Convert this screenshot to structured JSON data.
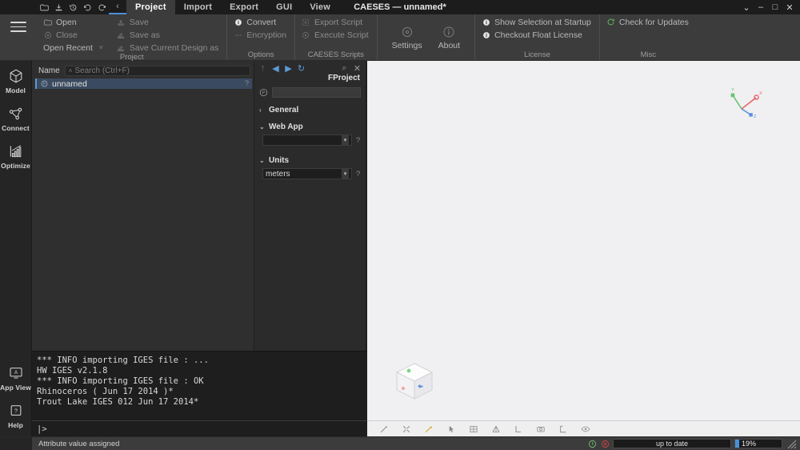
{
  "window": {
    "title": "CAESES — unnamed*",
    "controls": [
      {
        "name": "chevron-down-icon",
        "glyph": "⌄"
      },
      {
        "name": "minimize-button",
        "glyph": "–"
      },
      {
        "name": "maximize-button",
        "glyph": "□"
      },
      {
        "name": "close-button",
        "glyph": "✕"
      }
    ]
  },
  "quick_access": [
    {
      "name": "open-folder-icon",
      "tooltip": "Open"
    },
    {
      "name": "save-icon",
      "tooltip": "Save"
    },
    {
      "name": "history-icon",
      "tooltip": "History"
    },
    {
      "name": "undo-icon",
      "tooltip": "Undo"
    },
    {
      "name": "redo-icon",
      "tooltip": "Redo"
    }
  ],
  "ribbon": {
    "collapse_glyph": "‹",
    "tabs": [
      {
        "label": "Project",
        "active": true
      },
      {
        "label": "Import",
        "active": false
      },
      {
        "label": "Export",
        "active": false
      },
      {
        "label": "GUI",
        "active": false
      },
      {
        "label": "View",
        "active": false
      }
    ],
    "groups": [
      {
        "label": "Project",
        "columns": [
          [
            {
              "label": "Open",
              "icon": "folder-icon",
              "dim": false
            },
            {
              "label": "Close",
              "icon": "close-circle-icon",
              "dim": true
            },
            {
              "label": "Open Recent",
              "icon": "",
              "dim": false,
              "caret": "˅"
            }
          ],
          [
            {
              "label": "Save",
              "icon": "save-icon",
              "dim": true
            },
            {
              "label": "Save as",
              "icon": "save-as-icon",
              "dim": true
            },
            {
              "label": "Save Current Design as",
              "icon": "save-design-icon",
              "dim": true
            }
          ]
        ]
      },
      {
        "label": "Options",
        "columns": [
          [
            {
              "label": "Convert",
              "icon": "info-icon",
              "dim": false
            },
            {
              "label": "Encryption",
              "icon": "dots-icon",
              "dim": true
            }
          ]
        ]
      },
      {
        "label": "CAESES Scripts",
        "columns": [
          [
            {
              "label": "Export Script",
              "icon": "export-script-icon",
              "dim": true
            },
            {
              "label": "Execute Script",
              "icon": "execute-script-icon",
              "dim": true
            }
          ]
        ]
      },
      {
        "label": "",
        "buttons": [
          {
            "label": "Settings",
            "icon": "settings-gear-icon"
          },
          {
            "label": "About",
            "icon": "about-info-icon"
          }
        ]
      },
      {
        "label": "License",
        "columns": [
          [
            {
              "label": "Show Selection at Startup",
              "icon": "info-icon",
              "dim": false
            },
            {
              "label": "Checkout Float License",
              "icon": "info-icon",
              "dim": false
            }
          ]
        ]
      },
      {
        "label": "Misc",
        "columns": [
          [
            {
              "label": "Check for Updates",
              "icon": "refresh-icon",
              "dim": false
            }
          ]
        ]
      }
    ]
  },
  "rail": {
    "menu_icon": "hamburger-menu-icon",
    "items": [
      {
        "label": "Model",
        "icon": "cube-icon"
      },
      {
        "label": "Connect",
        "icon": "node-graph-icon"
      },
      {
        "label": "Optimize",
        "icon": "bar-chart-icon"
      }
    ],
    "bottom_items": [
      {
        "label": "App View",
        "icon": "app-view-icon"
      },
      {
        "label": "Help",
        "icon": "help-question-icon"
      }
    ]
  },
  "tree": {
    "column_header": "Name",
    "search_placeholder": "Search (Ctrl+F)",
    "search_value": "",
    "sort_glyph": "˄",
    "rows": [
      {
        "label": "unnamed",
        "icon": "project-p-icon",
        "selected": true,
        "help": "?"
      }
    ]
  },
  "properties": {
    "nav": [
      {
        "name": "up-level-icon",
        "glyph": "↑",
        "state": "dim"
      },
      {
        "name": "back-icon",
        "glyph": "◀",
        "state": "blue"
      },
      {
        "name": "forward-icon",
        "glyph": "▶",
        "state": "blue"
      },
      {
        "name": "refresh-icon",
        "glyph": "↻",
        "state": "blue"
      },
      {
        "name": "search-icon",
        "glyph": "⌕",
        "state": "right"
      },
      {
        "name": "close-panel-icon",
        "glyph": "✕",
        "state": "right"
      }
    ],
    "type_label": "FProject",
    "name_value": "",
    "name_icon": "project-p-icon",
    "sections": [
      {
        "label": "General",
        "expanded": false,
        "chevron": "›",
        "rows": []
      },
      {
        "label": "Web App",
        "expanded": true,
        "chevron": "⌄",
        "rows": [
          {
            "value": "",
            "arrow": "▾",
            "help": "?"
          }
        ]
      },
      {
        "label": "Units",
        "expanded": true,
        "chevron": "⌄",
        "rows": [
          {
            "value": "meters",
            "arrow": "▾",
            "help": "?"
          }
        ]
      }
    ]
  },
  "viewport": {
    "axis_triad": {
      "x": {
        "label": "X",
        "color": "#e8646a"
      },
      "y": {
        "label": "Y",
        "color": "#66c46b"
      },
      "z": {
        "label": "Z",
        "color": "#5b8ede"
      }
    },
    "nav_cube": "navigation-cube",
    "toolbar": [
      {
        "name": "measure-icon",
        "glyph": "ruler",
        "accent": false
      },
      {
        "name": "fit-view-icon",
        "glyph": "fit",
        "accent": false
      },
      {
        "name": "magic-wand-icon",
        "glyph": "wand",
        "accent": true
      },
      {
        "name": "select-cursor-icon",
        "glyph": "cursor",
        "accent": false
      },
      {
        "name": "grid-icon",
        "glyph": "grid",
        "accent": false
      },
      {
        "name": "triangulation-icon",
        "glyph": "triangle",
        "accent": false
      },
      {
        "name": "coordinate-axes-icon",
        "glyph": "axes",
        "accent": false
      },
      {
        "name": "snapshot-camera-icon",
        "glyph": "camera",
        "accent": false
      },
      {
        "name": "corner-snap-icon",
        "glyph": "corner",
        "accent": false
      },
      {
        "name": "visibility-eye-icon",
        "glyph": "eye",
        "accent": false
      }
    ]
  },
  "console": {
    "lines": [
      "*** INFO importing IGES file : ...",
      "HW IGES v2.1.8",
      "*** INFO importing IGES file : OK",
      "Rhinoceros ( Jun 17 2014 )*",
      "Trout Lake IGES 012 Jun 17 2014*"
    ],
    "prompt": "|>",
    "input_value": ""
  },
  "statusbar": {
    "message": "Attribute value assigned",
    "clock_icon": "clock-icon",
    "error_icon": "error-circle-icon",
    "sync_status": "up to date",
    "progress_text": "19%",
    "progress_percent": 19,
    "resize_grip": "resize-grip-icon"
  },
  "colors": {
    "accent_blue": "#5b9bd5",
    "ribbon_bg": "#3c3c3c",
    "panel_bg": "#2f2f2f",
    "viewport_bg": "#f0f0f2",
    "console_bg": "#1e1e1e",
    "selection": "#3a4a60",
    "status_ok": "#6fbf73",
    "status_error": "#d04545"
  }
}
